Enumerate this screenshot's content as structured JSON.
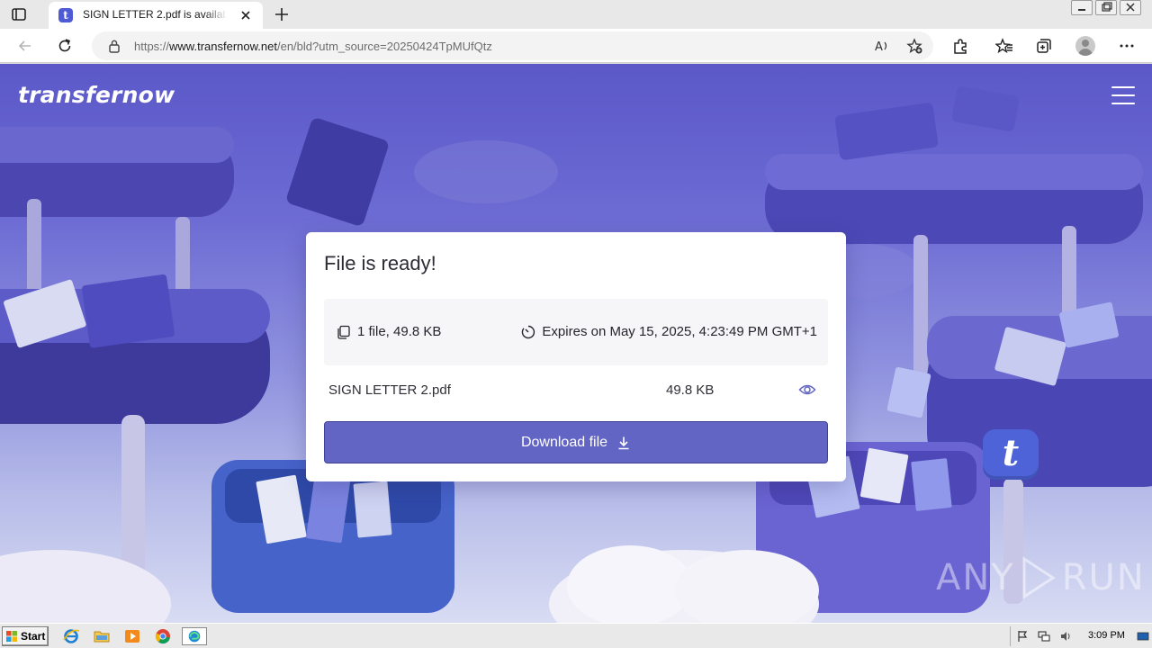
{
  "browser": {
    "tab": {
      "title": "SIGN LETTER 2.pdf is available f",
      "favicon_letter": "t"
    },
    "url": {
      "prefix": "https://",
      "host": "www.transfernow.net",
      "path": "/en/bld?utm_source=20250424TpMUfQtz"
    }
  },
  "page": {
    "brand": "transfernow",
    "card": {
      "title": "File is ready!",
      "summary_files": "1 file, 49.8 KB",
      "summary_expiry": "Expires on May 15, 2025, 4:23:49 PM GMT+1",
      "file_name": "SIGN LETTER 2.pdf",
      "file_size": "49.8 KB",
      "download_label": "Download file"
    },
    "logo_letter": "t",
    "watermark": {
      "left": "ANY",
      "right": "RUN"
    }
  },
  "taskbar": {
    "start_label": "Start",
    "clock": "3:09 PM",
    "apps": [
      "internet-explorer-icon",
      "folder-icon",
      "media-player-icon",
      "chrome-icon",
      "edge-icon"
    ]
  },
  "colors": {
    "brand_accent": "#6265c4",
    "hero_top": "#5b58c8",
    "card_bg": "#ffffff"
  }
}
